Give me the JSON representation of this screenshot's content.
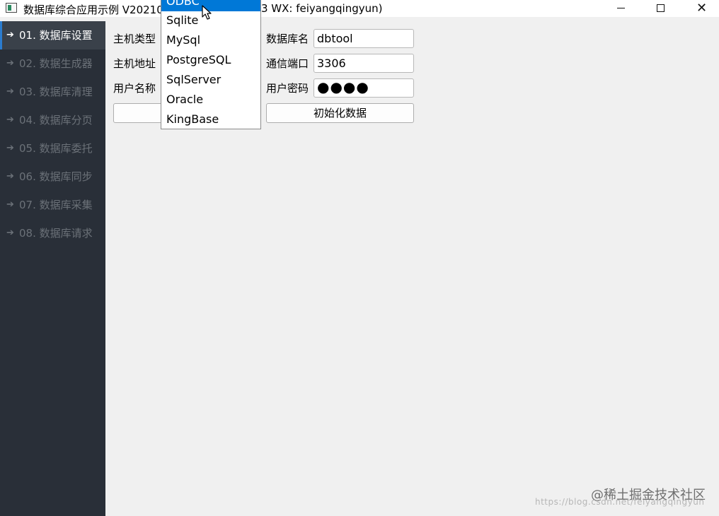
{
  "window": {
    "title": "数据库综合应用示例 V20210",
    "title_suffix": "3 WX: feiyangqingyun)",
    "minimize_glyph": "",
    "maximize_glyph": "",
    "close_glyph": "✕"
  },
  "sidebar": {
    "accent_color": "#2b7ccf",
    "items": [
      {
        "label": "01. 数据库设置",
        "active": true
      },
      {
        "label": "02. 数据生成器",
        "active": false
      },
      {
        "label": "03. 数据库清理",
        "active": false
      },
      {
        "label": "04. 数据库分页",
        "active": false
      },
      {
        "label": "05. 数据库委托",
        "active": false
      },
      {
        "label": "06. 数据库同步",
        "active": false
      },
      {
        "label": "07. 数据库采集",
        "active": false
      },
      {
        "label": "08. 数据库请求",
        "active": false
      }
    ]
  },
  "form": {
    "host_type_label": "主机类型",
    "host_address_label": "主机地址",
    "username_label": "用户名称",
    "db_name_label": "数据库名",
    "db_name_value": "dbtool",
    "port_label": "通信端口",
    "port_value": "3306",
    "password_label": "用户密码",
    "password_mask": "●●●●",
    "init_button_label": "初始化数据"
  },
  "dropdown": {
    "selected": "ODBC",
    "options": [
      "ODBC",
      "Sqlite",
      "MySql",
      "PostgreSQL",
      "SqlServer",
      "Oracle",
      "KingBase"
    ],
    "highlight_color": "#0078d7"
  },
  "watermark": {
    "text": "@稀土掘金技术社区",
    "url": "https://blog.csdn.net/feiyangqingyun"
  }
}
